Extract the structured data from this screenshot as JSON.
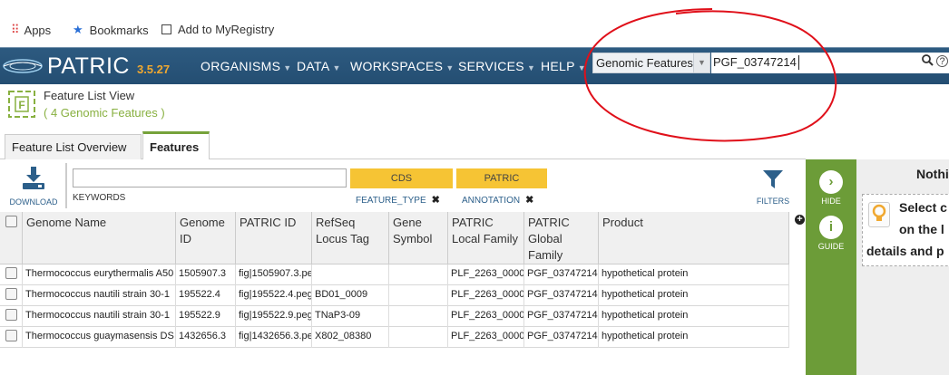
{
  "bookmarks_bar": {
    "items": [
      {
        "label": "Apps",
        "icon": "apps-grid-icon"
      },
      {
        "label": "Bookmarks",
        "icon": "star-icon"
      },
      {
        "label": "Add to MyRegistry",
        "icon": "checkbox-icon"
      }
    ]
  },
  "navbar": {
    "logo_text": "PATRIC",
    "version": "3.5.27",
    "menus": [
      "ORGANISMS",
      "DATA",
      "WORKSPACES",
      "SERVICES",
      "HELP"
    ],
    "search_type": "Genomic Features",
    "search_value": "PGF_03747214"
  },
  "header": {
    "title": "Feature List View",
    "count": "( 4 Genomic Features )"
  },
  "tabs": [
    {
      "label": "Feature List Overview",
      "active": false
    },
    {
      "label": "Features",
      "active": true
    }
  ],
  "toolbar": {
    "download_label": "DOWNLOAD",
    "keywords_label": "KEYWORDS",
    "keywords_value": "",
    "facets": [
      {
        "chip": "CDS",
        "label": "FEATURE_TYPE"
      },
      {
        "chip": "PATRIC",
        "label": "ANNOTATION"
      }
    ],
    "filters_label": "FILTERS"
  },
  "table": {
    "columns": [
      "Genome Name",
      "Genome ID",
      "PATRIC ID",
      "RefSeq Locus Tag",
      "Gene Symbol",
      "PATRIC Local Family",
      "PATRIC Global Family",
      "Product"
    ],
    "rows": [
      [
        "Thermococcus eurythermalis A50",
        "1505907.3",
        "fig|1505907.3.pe",
        "",
        "",
        "PLF_2263_0000",
        "PGF_03747214",
        "hypothetical protein"
      ],
      [
        "Thermococcus nautili strain 30-1",
        "195522.4",
        "fig|195522.4.peg",
        "BD01_0009",
        "",
        "PLF_2263_0000",
        "PGF_03747214",
        "hypothetical protein"
      ],
      [
        "Thermococcus nautili strain 30-1",
        "195522.9",
        "fig|195522.9.peg",
        "TNaP3-09",
        "",
        "PLF_2263_0000",
        "PGF_03747214",
        "hypothetical protein"
      ],
      [
        "Thermococcus guaymasensis DS",
        "1432656.3",
        "fig|1432656.3.pe",
        "X802_08380",
        "",
        "PLF_2263_0000",
        "PGF_03747214",
        "hypothetical protein"
      ]
    ]
  },
  "side": {
    "hide_label": "HIDE",
    "guide_label": "GUIDE",
    "title": "Nothi",
    "hint_line1": "Select c",
    "hint_line2": "on the l",
    "hint_line3": "details and p"
  },
  "colors": {
    "navbar": "#2d5a80",
    "accent_green": "#6c9c38",
    "chip_yellow": "#f6c434",
    "annotation_red": "#e0101a",
    "version_orange": "#f0a830"
  }
}
